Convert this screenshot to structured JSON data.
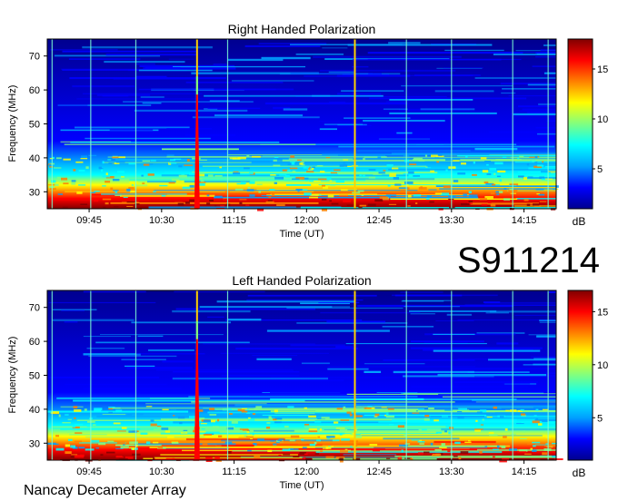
{
  "figure": {
    "id_label": "S911214",
    "footer": "Nancay Decameter Array"
  },
  "chart_data": [
    {
      "type": "heatmap",
      "title": "Right Handed Polarization",
      "xlabel": "Time (UT)",
      "ylabel": "Frequency (MHz)",
      "x_ticks": [
        "09:45",
        "10:30",
        "11:15",
        "12:00",
        "12:45",
        "13:30",
        "14:15"
      ],
      "x_tick_minutes": [
        585,
        630,
        675,
        720,
        765,
        810,
        855
      ],
      "xlim_minutes": [
        559,
        875
      ],
      "y_ticks": [
        30,
        40,
        50,
        60,
        70
      ],
      "ylim": [
        25,
        75
      ],
      "colorbar": {
        "label": "dB",
        "ticks": [
          5,
          10,
          15
        ],
        "range": [
          1,
          18
        ]
      },
      "colormap": [
        "#00008f",
        "#0000ff",
        "#00a0ff",
        "#00ffff",
        "#80ff80",
        "#ffff00",
        "#ff8000",
        "#ff0000",
        "#800000"
      ],
      "features": {
        "burst_minute": 652,
        "burst_top_mhz": 64,
        "vertical_lines_minutes": [
          562,
          586,
          614,
          671,
          750,
          782,
          810,
          848,
          870
        ],
        "strong_lines_minutes": [
          652,
          750
        ]
      }
    },
    {
      "type": "heatmap",
      "title": "Left Handed Polarization",
      "xlabel": "Time (UT)",
      "ylabel": "Frequency (MHz)",
      "x_ticks": [
        "09:45",
        "10:30",
        "11:15",
        "12:00",
        "12:45",
        "13:30",
        "14:15"
      ],
      "x_tick_minutes": [
        585,
        630,
        675,
        720,
        765,
        810,
        855
      ],
      "xlim_minutes": [
        559,
        875
      ],
      "y_ticks": [
        30,
        40,
        50,
        60,
        70
      ],
      "ylim": [
        25,
        75
      ],
      "colorbar": {
        "label": "dB",
        "ticks": [
          5,
          10,
          15
        ],
        "range": [
          1,
          17
        ]
      },
      "colormap": [
        "#00008f",
        "#0000ff",
        "#00a0ff",
        "#00ffff",
        "#80ff80",
        "#ffff00",
        "#ff8000",
        "#ff0000",
        "#800000"
      ],
      "features": {
        "burst_minute": 652,
        "burst_top_mhz": 66,
        "vertical_lines_minutes": [
          562,
          586,
          614,
          671,
          750,
          782,
          810,
          848,
          870
        ],
        "strong_lines_minutes": [
          652,
          750
        ]
      }
    }
  ]
}
